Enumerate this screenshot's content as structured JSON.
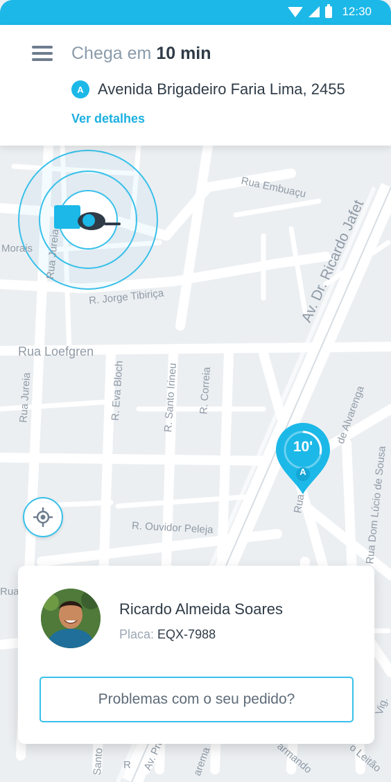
{
  "status_bar": {
    "time": "12:30"
  },
  "header": {
    "eta_prefix": "Chega em",
    "eta_value": "10 min",
    "address_marker": "A",
    "address": "Avenida Brigadeiro Faria Lima, 2455",
    "details_link": "Ver detalhes"
  },
  "map": {
    "streets": {
      "rua_embuacu": "Rua Embuaçu",
      "av_ricardo_jafet": "Av. Dr. Ricardo Jafet",
      "morais": "Morais",
      "rua_jureia_top": "Rua Jureia",
      "r_jorge_tibirica": "R. Jorge Tibiriça",
      "rua_loefgren": "Rua Loefgren",
      "rua_jureia": "Rua Jureia",
      "r_eva_bloch": "R. Eva Bloch",
      "r_santo_irineu": "R. Santo Irineu",
      "r_correia": "R. Correia",
      "de_alvarenga": "de Alvarenga",
      "rua_dom_lucio": "Rua Dom Lúcio de Sousa",
      "r_ouvidor_peleja": "R. Ouvidor Peleja",
      "rua_left": "Rua",
      "rua_diag": "Rua",
      "vig": "Vig.",
      "santo_bottom": "Santo",
      "r_bottom": "R",
      "av_pro": "Av. Pro",
      "arema": "arema",
      "armando": "armando",
      "o_leitao": "o Leitão"
    },
    "destination_pin": {
      "eta": "10'",
      "letter": "A"
    }
  },
  "driver": {
    "name": "Ricardo Almeida Soares",
    "plate_label": "Placa:",
    "plate": "EQX-7988"
  },
  "actions": {
    "problems_button": "Problemas com o seu pedido?"
  },
  "colors": {
    "accent": "#1cb8e8",
    "text_dark": "#2f3b47",
    "text_muted": "#8a9bab",
    "map_bg": "#eceff2",
    "road": "#ffffff"
  }
}
